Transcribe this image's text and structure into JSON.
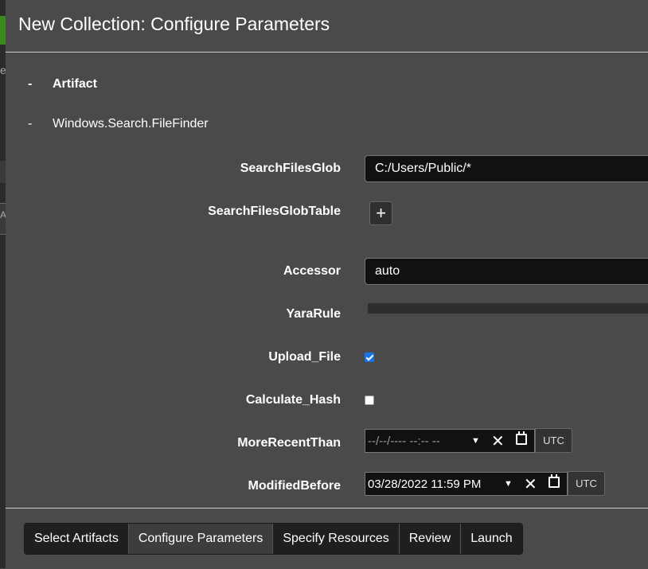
{
  "modal": {
    "title": "New Collection: Configure Parameters"
  },
  "artifacts": {
    "header_dash": "-",
    "header_label": "Artifact",
    "item_dash": "-",
    "item_label": "Windows.Search.FileFinder"
  },
  "params": {
    "search_files_glob": {
      "label": "SearchFilesGlob",
      "value": "C:/Users/Public/*"
    },
    "search_files_glob_table": {
      "label": "SearchFilesGlobTable",
      "button": "+"
    },
    "accessor": {
      "label": "Accessor",
      "value": "auto"
    },
    "yara_rule": {
      "label": "YaraRule"
    },
    "upload_file": {
      "label": "Upload_File",
      "checked": true
    },
    "calculate_hash": {
      "label": "Calculate_Hash",
      "checked": false
    },
    "more_recent_than": {
      "label": "MoreRecentThan",
      "value": "--/--/---- --:-- --",
      "tz": "UTC"
    },
    "modified_before": {
      "label": "ModifiedBefore",
      "value": "03/28/2022 11:59 PM",
      "tz": "UTC"
    }
  },
  "icons": {
    "dropdown": "chevron-down-icon",
    "clear": "close-icon",
    "calendar": "calendar-icon",
    "checkbox": "check-icon"
  },
  "colors": {
    "background": "#4a4a4a",
    "input_bg": "#111111",
    "checkbox_accent": "#1a73e8"
  },
  "footer": {
    "nav": [
      {
        "label": "Select Artifacts"
      },
      {
        "label": "Configure Parameters",
        "active": true
      },
      {
        "label": "Specify Resources"
      },
      {
        "label": "Review"
      },
      {
        "label": "Launch"
      }
    ]
  }
}
